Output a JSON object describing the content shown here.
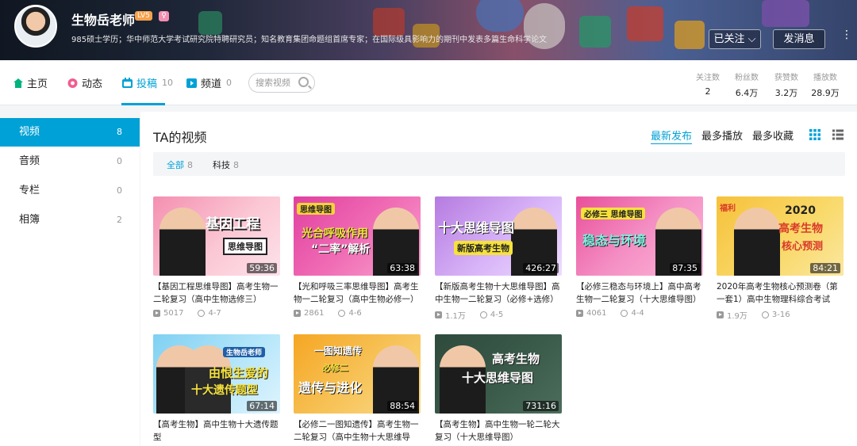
{
  "header": {
    "username": "生物岳老师",
    "level": "LV5",
    "gender_badge": "♀",
    "signature": "985硕士学历；华中师范大学考试研究院特聘研究员；知名教育集团命题组首席专家；在国际级具影响力的期刊中发表多篇生命科学论文",
    "follow_label": "已关注",
    "message_label": "发消息",
    "more_label": "⋮"
  },
  "nav": {
    "tabs": [
      {
        "label": "主页",
        "count": ""
      },
      {
        "label": "动态",
        "count": ""
      },
      {
        "label": "投稿",
        "count": "10"
      },
      {
        "label": "频道",
        "count": "0"
      }
    ],
    "search_placeholder": "搜索视频",
    "stats": [
      {
        "label": "关注数",
        "value": "2"
      },
      {
        "label": "粉丝数",
        "value": "6.4万"
      },
      {
        "label": "获赞数",
        "value": "3.2万"
      },
      {
        "label": "播放数",
        "value": "28.9万"
      }
    ]
  },
  "sidebar": {
    "items": [
      {
        "label": "视频",
        "count": "8"
      },
      {
        "label": "音频",
        "count": "0"
      },
      {
        "label": "专栏",
        "count": "0"
      },
      {
        "label": "相簿",
        "count": "2"
      }
    ]
  },
  "main": {
    "title": "TA的视频",
    "sort_options": [
      "最新发布",
      "最多播放",
      "最多收藏"
    ],
    "filters": [
      {
        "label": "全部",
        "count": "8"
      },
      {
        "label": "科技",
        "count": "8"
      }
    ],
    "videos": [
      {
        "thumb_text": [
          "基因工程",
          "思维导图"
        ],
        "duration": "59:36",
        "title": "【基因工程思维导图】高考生物一二轮复习（高中生物选修三）",
        "plays": "5017",
        "date": "4-7"
      },
      {
        "thumb_text": [
          "思维导图",
          "光合呼吸作用",
          "“二率”解析"
        ],
        "duration": "63:38",
        "title": "【光和呼吸三率思维导图】高考生物一二轮复习（高中生物必修一）",
        "plays": "2861",
        "date": "4-6"
      },
      {
        "thumb_text": [
          "十大思维导图",
          "新版高考生物"
        ],
        "duration": "426:27",
        "title": "【新版高考生物十大思维导图】高中生物一二轮复习（必修+选修）",
        "plays": "1.1万",
        "date": "4-5"
      },
      {
        "thumb_text": [
          "必修三 思维导图",
          "稳态与环境"
        ],
        "duration": "87:35",
        "title": "【必修三稳态与环境上】高中高考生物一二轮复习（十大思维导图）",
        "plays": "4061",
        "date": "4-4"
      },
      {
        "thumb_text": [
          "福利",
          "2020",
          "高考生物",
          "核心预测"
        ],
        "duration": "84:21",
        "title": "2020年高考生物核心预测卷（第一套1）高中生物理科综合考试",
        "plays": "1.9万",
        "date": "3-16"
      },
      {
        "thumb_text": [
          "生物岳老师",
          "由恨生爱的",
          "十大遗传题型"
        ],
        "duration": "67:14",
        "title": "【高考生物】高中生物十大遗传题型",
        "plays": "",
        "date": ""
      },
      {
        "thumb_text": [
          "一图知遗传",
          "必修二",
          "遗传与进化"
        ],
        "duration": "88:54",
        "title": "【必修二一图知遗传】高考生物一二轮复习（高中生物十大思维导",
        "plays": "",
        "date": ""
      },
      {
        "thumb_text": [
          "高考生物",
          "十大思维导图"
        ],
        "duration": "731:16",
        "title": "【高考生物】高中生物一轮二轮大复习（十大思维导图）",
        "plays": "",
        "date": ""
      }
    ]
  },
  "colors": {
    "accent": "#00a1d6"
  }
}
